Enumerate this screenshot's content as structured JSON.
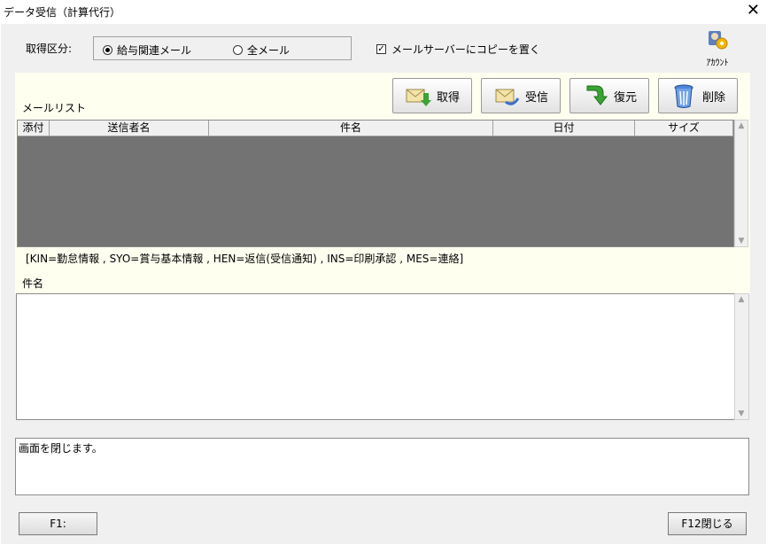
{
  "window": {
    "title": "データ受信（計算代行）",
    "close_label": "✕"
  },
  "filter": {
    "label": "取得区分:",
    "options": [
      {
        "label": "給与関連メール",
        "selected": true
      },
      {
        "label": "全メール",
        "selected": false
      }
    ],
    "copy_checkbox": {
      "label": "メールサーバーにコピーを置く",
      "checked": true,
      "mark": "✓"
    }
  },
  "account": {
    "label": "ｱｶｳﾝﾄ"
  },
  "mail_list": {
    "label": "メールリスト",
    "buttons": [
      {
        "label": "取得",
        "icon": "envelope-download-icon"
      },
      {
        "label": "受信",
        "icon": "envelope-receive-icon"
      },
      {
        "label": "復元",
        "icon": "restore-arrow-icon"
      },
      {
        "label": "削除",
        "icon": "trash-icon"
      }
    ],
    "columns": [
      "添付",
      "送信者名",
      "件名",
      "日付",
      "サイズ"
    ],
    "rows": []
  },
  "legend": "[KIN=勤怠情報 , SYO=賞与基本情報 , HEN=返信(受信通知) , INS=印刷承認 , MES=連絡]",
  "subject": {
    "label": "件名",
    "value": ""
  },
  "status_message": "画面を閉じます。",
  "function_keys": {
    "f1": "F1:",
    "f12": "F12閉じる"
  },
  "colors": {
    "grid_background": "#737373",
    "panel_background": "#fffff0",
    "dialog_background": "#f0f0f0"
  }
}
